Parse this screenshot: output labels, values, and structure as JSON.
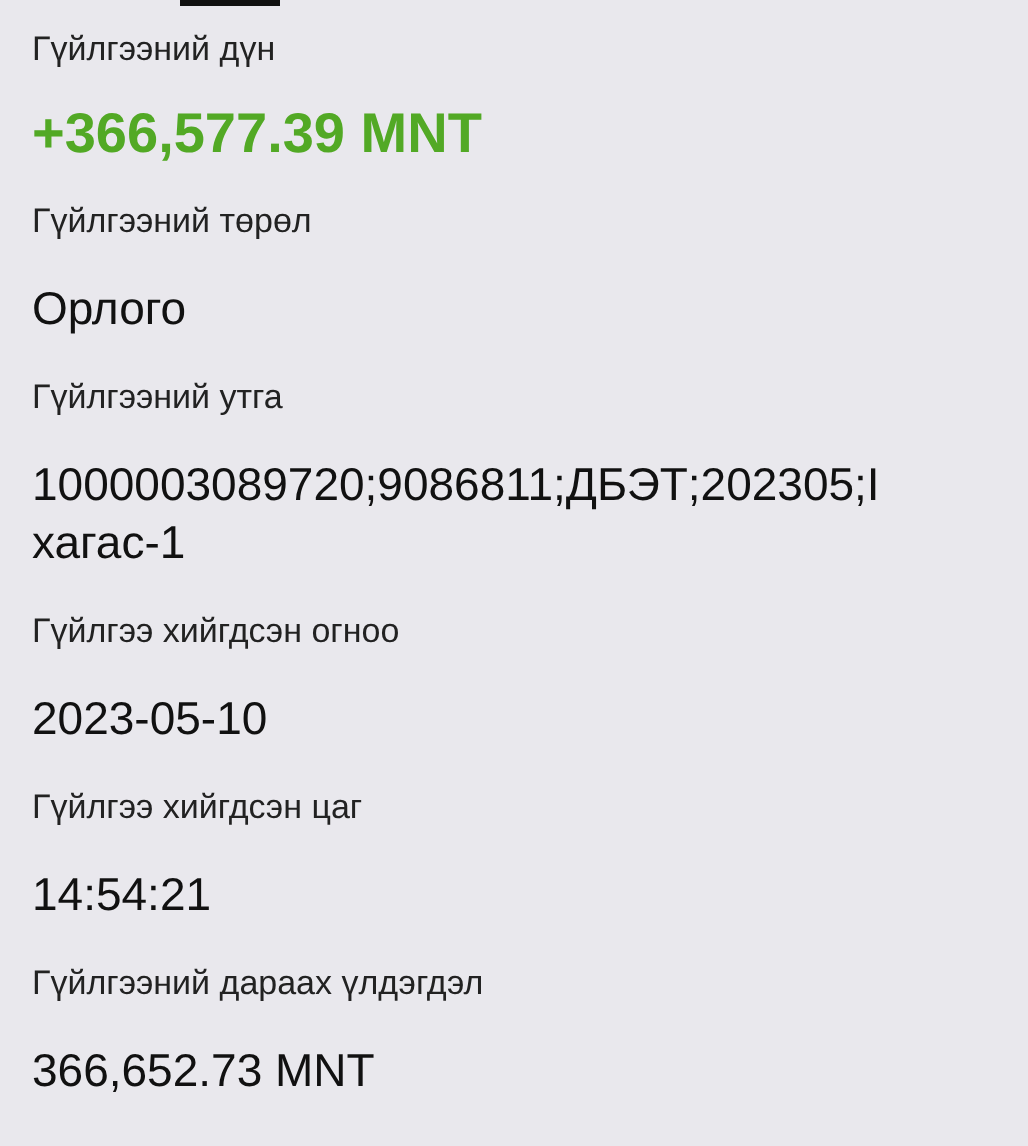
{
  "fields": [
    {
      "label": "Гүйлгээний дүн",
      "value": "+366,577.39 MNT",
      "kind": "amount"
    },
    {
      "label": "Гүйлгээний төрөл",
      "value": "Орлого",
      "kind": "text"
    },
    {
      "label": "Гүйлгээний утга",
      "value": "1000003089720;9086811;ДБЭТ;202305;I хагас-1",
      "kind": "text"
    },
    {
      "label": "Гүйлгээ хийгдсэн огноо",
      "value": "2023-05-10",
      "kind": "text"
    },
    {
      "label": "Гүйлгээ хийгдсэн цаг",
      "value": "14:54:21",
      "kind": "text"
    },
    {
      "label": "Гүйлгээний дараах үлдэгдэл",
      "value": "366,652.73 MNT",
      "kind": "text"
    }
  ]
}
